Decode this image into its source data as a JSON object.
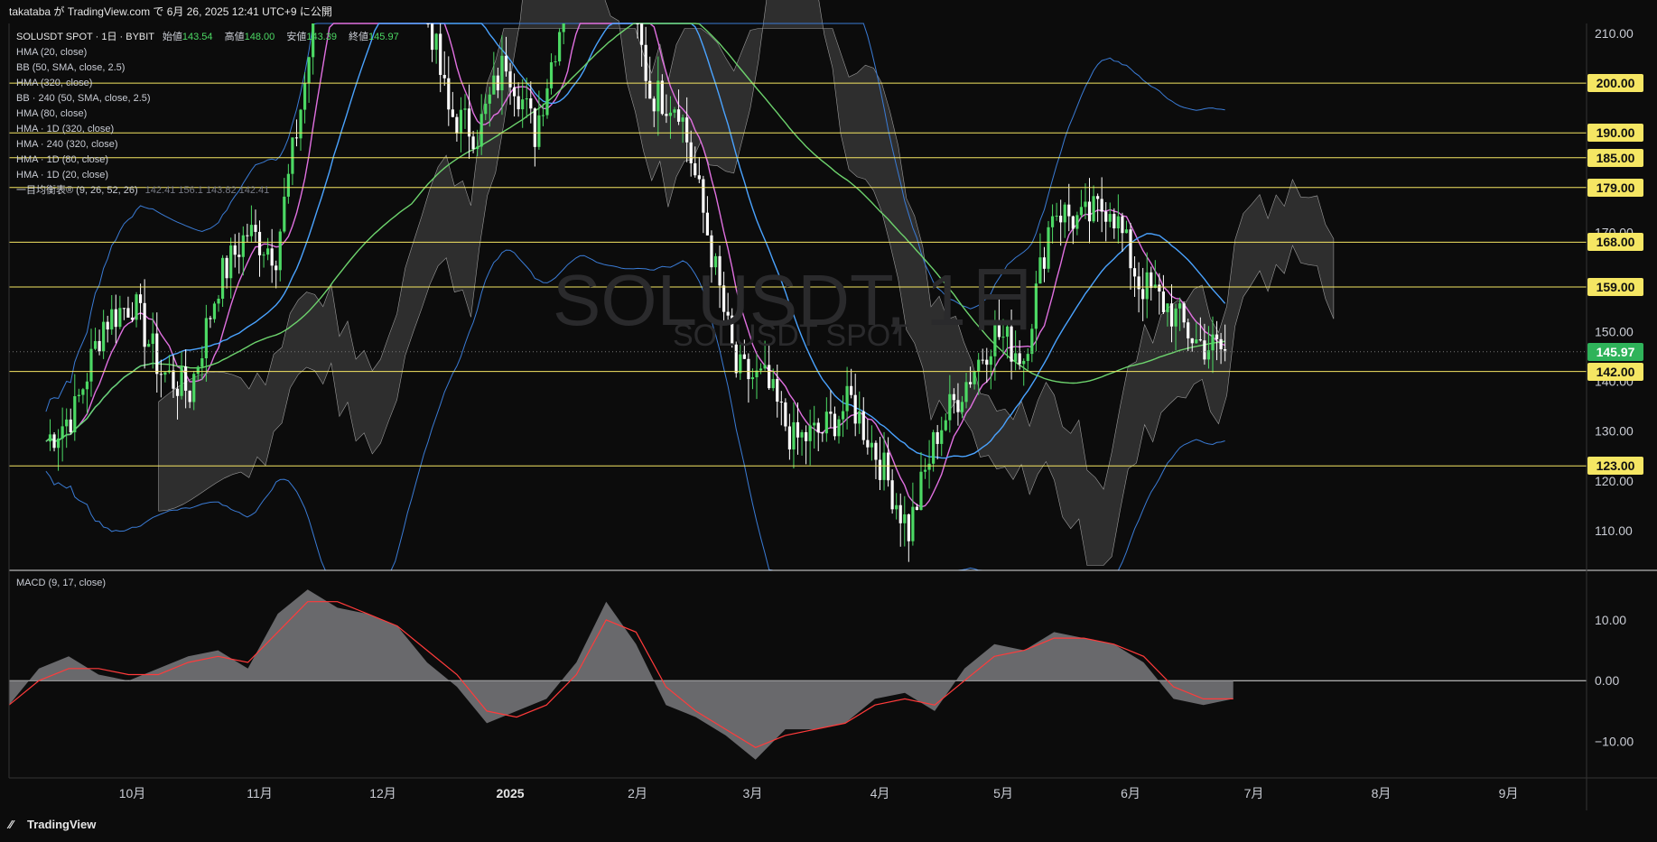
{
  "header": {
    "publish_info": "takataba が TradingView.com で 6月 26, 2025 12:41 UTC+9 に公開"
  },
  "legend": {
    "symbol": "SOLUSDT SPOT · 1日 · BYBIT",
    "open_label": "始値",
    "open": "143.54",
    "high_label": "高値",
    "high": "148.00",
    "low_label": "安値",
    "low": "143.39",
    "close_label": "終値",
    "close": "145.97",
    "indicators": [
      "HMA (20, close)",
      "BB (50, SMA, close, 2.5)",
      "HMA (320, close)",
      "BB · 240 (50, SMA, close, 2.5)",
      "HMA (80, close)",
      "HMA · 1D (320, close)",
      "HMA · 240 (320, close)",
      "HMA · 1D (80, close)",
      "HMA · 1D (20, close)"
    ],
    "ichimoku_label": "一目均衡表® (9, 26, 52, 26)",
    "ichimoku_values": "142.41  156.1  143.82  142.41"
  },
  "watermark": {
    "main": "SOLUSDT, 1日",
    "sub": "SOLUSDT SPOT"
  },
  "macd_label": "MACD (9, 17, close)",
  "footer": {
    "brand": "TradingView"
  },
  "colors": {
    "background": "#0c0c0c",
    "candle_up": "#4cd964",
    "candle_down": "#ffffff",
    "level_line": "#f5e663",
    "hma20": "#e070e0",
    "hma80": "#4aa3ff",
    "hma320": "#6dd36d",
    "bb": "#3a7bd5",
    "cloud": "#4a4a4a",
    "macd_area": "#7a7a7e",
    "macd_signal": "#ff3b3b",
    "current_price_tag": "#2fb35a"
  },
  "chart_data": {
    "type": "candlestick",
    "title": "SOLUSDT, 1日",
    "price_axis": {
      "ylim": [
        102,
        212
      ],
      "ticks": [
        110,
        120,
        130,
        140,
        150,
        170,
        210
      ]
    },
    "time_axis_labels": [
      "10月",
      "11月",
      "12月",
      "2025",
      "2月",
      "3月",
      "4月",
      "5月",
      "6月",
      "7月",
      "8月",
      "9月"
    ],
    "horizontal_levels": [
      200,
      190,
      185,
      179,
      168,
      159,
      142,
      123
    ],
    "horizontal_level_labels": [
      "200.00",
      "190.00",
      "185.00",
      "179.00",
      "168.00",
      "159.00",
      "142.00",
      "123.00"
    ],
    "current_price": 145.97,
    "current_price_label": "145.97",
    "price_path_weekly": [
      {
        "date": "2024-09-10",
        "close": 128
      },
      {
        "date": "2024-09-17",
        "close": 134
      },
      {
        "date": "2024-09-24",
        "close": 152
      },
      {
        "date": "2024-10-01",
        "close": 156
      },
      {
        "date": "2024-10-08",
        "close": 142
      },
      {
        "date": "2024-10-15",
        "close": 138
      },
      {
        "date": "2024-10-22",
        "close": 160
      },
      {
        "date": "2024-10-29",
        "close": 170
      },
      {
        "date": "2024-11-05",
        "close": 166
      },
      {
        "date": "2024-11-12",
        "close": 200
      },
      {
        "date": "2024-11-19",
        "close": 240
      },
      {
        "date": "2024-11-26",
        "close": 235
      },
      {
        "date": "2024-12-03",
        "close": 232
      },
      {
        "date": "2024-12-10",
        "close": 222
      },
      {
        "date": "2024-12-17",
        "close": 194
      },
      {
        "date": "2024-12-24",
        "close": 190
      },
      {
        "date": "2024-12-31",
        "close": 205
      },
      {
        "date": "2025-01-07",
        "close": 190
      },
      {
        "date": "2025-01-14",
        "close": 215
      },
      {
        "date": "2025-01-21",
        "close": 240
      },
      {
        "date": "2025-01-28",
        "close": 228
      },
      {
        "date": "2025-02-04",
        "close": 198
      },
      {
        "date": "2025-02-11",
        "close": 196
      },
      {
        "date": "2025-02-18",
        "close": 170
      },
      {
        "date": "2025-02-25",
        "close": 142
      },
      {
        "date": "2025-03-04",
        "close": 140
      },
      {
        "date": "2025-03-11",
        "close": 128
      },
      {
        "date": "2025-03-18",
        "close": 130
      },
      {
        "date": "2025-03-25",
        "close": 136
      },
      {
        "date": "2025-04-01",
        "close": 124
      },
      {
        "date": "2025-04-08",
        "close": 110
      },
      {
        "date": "2025-04-15",
        "close": 130
      },
      {
        "date": "2025-04-22",
        "close": 140
      },
      {
        "date": "2025-04-29",
        "close": 150
      },
      {
        "date": "2025-05-06",
        "close": 145
      },
      {
        "date": "2025-05-13",
        "close": 175
      },
      {
        "date": "2025-05-20",
        "close": 172
      },
      {
        "date": "2025-05-27",
        "close": 176
      },
      {
        "date": "2025-06-03",
        "close": 160
      },
      {
        "date": "2025-06-10",
        "close": 155
      },
      {
        "date": "2025-06-17",
        "close": 148
      },
      {
        "date": "2025-06-24",
        "close": 145.97
      }
    ],
    "macd_panel": {
      "label": "MACD (9, 17, close)",
      "ylim": [
        -16,
        18
      ],
      "ticks": [
        10,
        0,
        -10
      ],
      "tick_labels": [
        "10.00",
        "0.00",
        "−10.00"
      ],
      "macd": [
        -4,
        2,
        4,
        1,
        0,
        2,
        4,
        5,
        2,
        11,
        15,
        12,
        11,
        9,
        3,
        -1,
        -7,
        -5,
        -3,
        3,
        13,
        6,
        -4,
        -6,
        -9,
        -13,
        -8,
        -8,
        -7,
        -3,
        -2,
        -5,
        2,
        6,
        5,
        8,
        7,
        6,
        3,
        -3,
        -4,
        -3
      ],
      "signal": [
        -4,
        0,
        2,
        2,
        1,
        1,
        3,
        4,
        3,
        8,
        13,
        13,
        11,
        9,
        5,
        1,
        -5,
        -6,
        -4,
        1,
        10,
        8,
        -1,
        -5,
        -8,
        -11,
        -9,
        -8,
        -7,
        -4,
        -3,
        -4,
        0,
        4,
        5,
        7,
        7,
        6,
        4,
        -1,
        -3,
        -3
      ]
    }
  }
}
